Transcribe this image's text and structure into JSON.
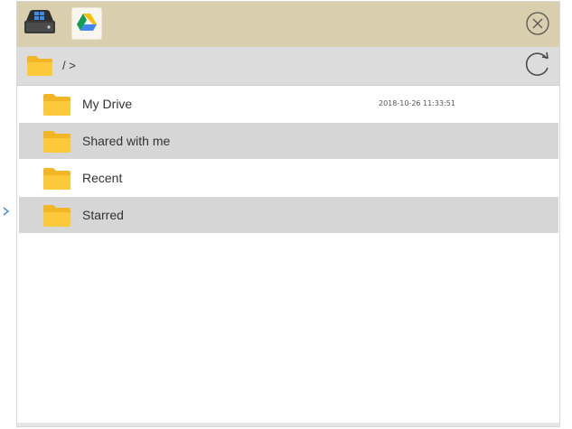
{
  "header": {
    "tabs": [
      {
        "icon": "hard-drive-icon",
        "active": false
      },
      {
        "icon": "google-drive-icon",
        "active": true
      }
    ],
    "close_icon": "close-circle-icon"
  },
  "pathbar": {
    "path": "/ >",
    "refresh_icon": "refresh-icon"
  },
  "files": [
    {
      "name": "My Drive",
      "date": "2018-10-26 11:33:51"
    },
    {
      "name": "Shared with me",
      "date": ""
    },
    {
      "name": "Recent",
      "date": ""
    },
    {
      "name": "Starred",
      "date": ""
    }
  ],
  "colors": {
    "titlebar": "#d9cfae",
    "pathbar": "#dcdcdc",
    "row_alt": "#d6d6d6",
    "folder": "#fcc93a",
    "left_arrow": "#4a90d9"
  }
}
